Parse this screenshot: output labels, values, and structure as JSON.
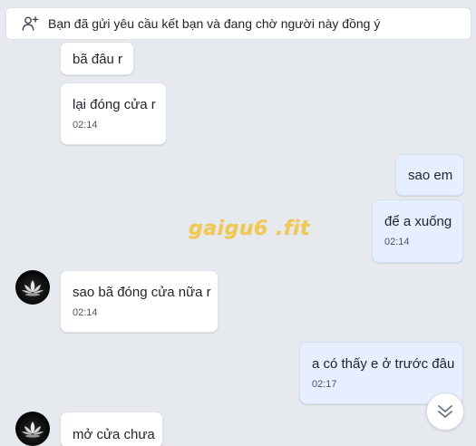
{
  "banner": {
    "text": "Bạn đã gửi yêu cầu kết bạn và đang chờ người này đồng ý",
    "icon": "add-friend-icon"
  },
  "watermark": "gaigu6 .fit",
  "messages": [
    {
      "direction": "incoming",
      "text": "bã đâu r",
      "time": ""
    },
    {
      "direction": "incoming",
      "text": "lại đóng cửa r",
      "time": "02:14"
    },
    {
      "direction": "outgoing",
      "text": "sao em",
      "time": ""
    },
    {
      "direction": "outgoing",
      "text": "để a xuống",
      "time": "02:14"
    },
    {
      "direction": "incoming",
      "text": "sao bã đóng cửa nữa r",
      "time": "02:14",
      "avatar": true
    },
    {
      "direction": "outgoing",
      "text": "a có thấy e ở trước đâu",
      "time": "02:17"
    },
    {
      "direction": "incoming",
      "text": "mở cửa chưa",
      "time": "",
      "avatar": true
    }
  ],
  "colors": {
    "background": "#e6e9ee",
    "incoming_bubble": "#ffffff",
    "outgoing_bubble": "#e5efff",
    "watermark": "#f2c94c"
  },
  "scroll_button_icon": "chevron-double-down-icon"
}
